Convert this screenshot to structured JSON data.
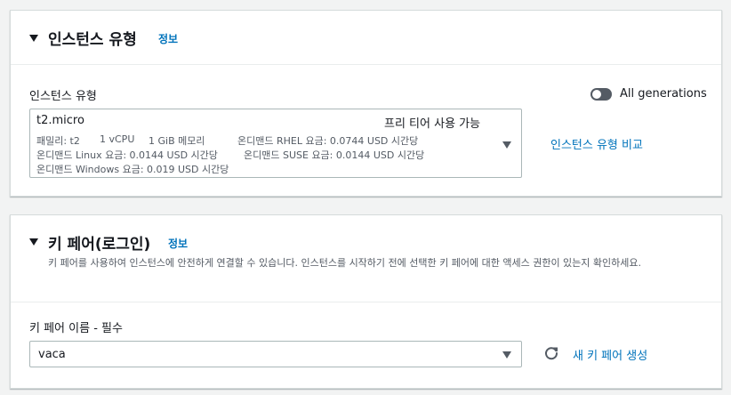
{
  "instance_type_section": {
    "title": "인스턴스 유형",
    "info": "정보",
    "field_label": "인스턴스 유형",
    "all_generations_label": "All generations",
    "all_generations_enabled": false,
    "selected": {
      "name": "t2.micro",
      "badge": "프리 티어 사용 가능",
      "family": "패밀리: t2",
      "vcpu": "1 vCPU",
      "memory": "1 GiB 메모리",
      "rhel_price": "온디맨드 RHEL 요금: 0.0744 USD 시간당",
      "linux_price": "온디맨드 Linux 요금: 0.0144 USD 시간당",
      "suse_price": "온디맨드 SUSE 요금: 0.0144 USD 시간당",
      "windows_price": "온디맨드 Windows 요금: 0.019 USD 시간당"
    },
    "compare_link": "인스턴스 유형 비교"
  },
  "key_pair_section": {
    "title": "키 페어(로그인)",
    "info": "정보",
    "description": "키 페어를 사용하여 인스턴스에 안전하게 연결할 수 있습니다. 인스턴스를 시작하기 전에 선택한 키 페어에 대한 액세스 권한이 있는지 확인하세요.",
    "field_label": "키 페어 이름 - 필수",
    "selected_value": "vaca",
    "create_link": "새 키 페어 생성"
  },
  "colors": {
    "link": "#0073bb",
    "text": "#16191f",
    "secondary_text": "#545b64",
    "background": "#f2f3f3",
    "border": "#aab7b8"
  }
}
